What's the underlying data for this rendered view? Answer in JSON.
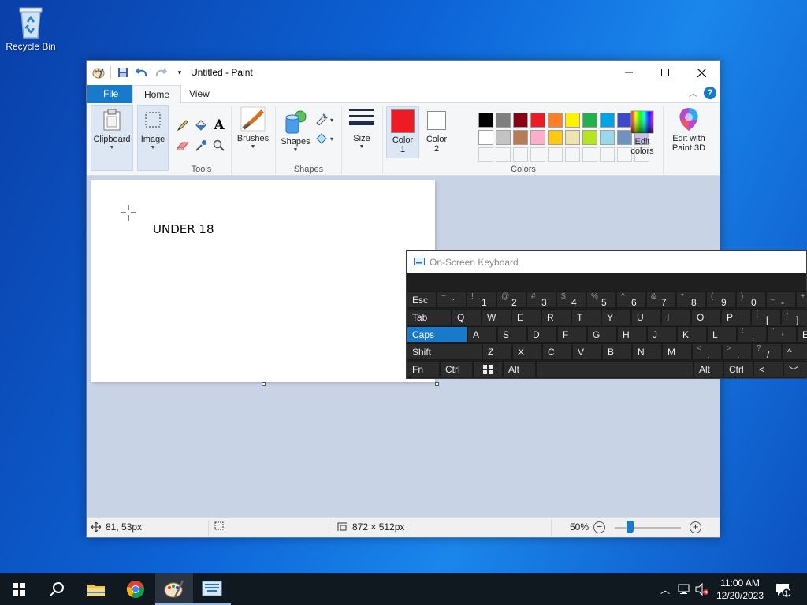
{
  "desktop": {
    "recycle_bin_label": "Recycle Bin"
  },
  "paint": {
    "title": "Untitled - Paint",
    "tabs": {
      "file": "File",
      "home": "Home",
      "view": "View"
    },
    "ribbon": {
      "clipboard": "Clipboard",
      "image": "Image",
      "tools_group": "Tools",
      "brushes": "Brushes",
      "shapes": "Shapes",
      "shapes_group": "Shapes",
      "size": "Size",
      "color1_a": "Color",
      "color1_b": "1",
      "color2_a": "Color",
      "color2_b": "2",
      "colors_group": "Colors",
      "edit_colors_a": "Edit",
      "edit_colors_b": "colors",
      "paint3d_a": "Edit with",
      "paint3d_b": "Paint 3D"
    },
    "color1": "#ed1c24",
    "color2": "#ffffff",
    "palette_row1": [
      "#000000",
      "#7f7f7f",
      "#880015",
      "#ed1c24",
      "#ff7f27",
      "#fff200",
      "#22b14c",
      "#00a2e8",
      "#3f48cc",
      "#a349a4"
    ],
    "palette_row2": [
      "#ffffff",
      "#c3c3c3",
      "#b97a57",
      "#ffaec9",
      "#ffc90e",
      "#efe4b0",
      "#b5e61d",
      "#99d9ea",
      "#7092be",
      "#c8bfe7"
    ],
    "canvas_text": "UNDER 18",
    "status": {
      "cursor_pos": "81, 53px",
      "canvas_size": "872 × 512px",
      "zoom": "50%"
    }
  },
  "osk": {
    "title": "On-Screen Keyboard",
    "row1": [
      {
        "main": "Esc"
      },
      {
        "shift": "~",
        "base": "`"
      },
      {
        "shift": "!",
        "base": "1"
      },
      {
        "shift": "@",
        "base": "2"
      },
      {
        "shift": "#",
        "base": "3"
      },
      {
        "shift": "$",
        "base": "4"
      },
      {
        "shift": "%",
        "base": "5"
      },
      {
        "shift": "^",
        "base": "6"
      },
      {
        "shift": "&",
        "base": "7"
      },
      {
        "shift": "*",
        "base": "8"
      },
      {
        "shift": "(",
        "base": "9"
      },
      {
        "shift": ")",
        "base": "0"
      },
      {
        "shift": "_",
        "base": "-"
      },
      {
        "shift": "+",
        "base": "="
      }
    ],
    "row2": [
      {
        "main": "Tab"
      },
      {
        "main": "Q"
      },
      {
        "main": "W"
      },
      {
        "main": "E"
      },
      {
        "main": "R"
      },
      {
        "main": "T"
      },
      {
        "main": "Y"
      },
      {
        "main": "U"
      },
      {
        "main": "I"
      },
      {
        "main": "O"
      },
      {
        "main": "P"
      },
      {
        "shift": "{",
        "base": "["
      },
      {
        "shift": "}",
        "base": "]"
      }
    ],
    "row3": [
      {
        "main": "Caps"
      },
      {
        "main": "A"
      },
      {
        "main": "S"
      },
      {
        "main": "D"
      },
      {
        "main": "F"
      },
      {
        "main": "G"
      },
      {
        "main": "H"
      },
      {
        "main": "J"
      },
      {
        "main": "K"
      },
      {
        "main": "L"
      },
      {
        "shift": ":",
        "base": ";"
      },
      {
        "shift": "\"",
        "base": "'"
      },
      {
        "main": "En"
      }
    ],
    "row4": [
      {
        "main": "Shift"
      },
      {
        "main": "Z"
      },
      {
        "main": "X"
      },
      {
        "main": "C"
      },
      {
        "main": "V"
      },
      {
        "main": "B"
      },
      {
        "main": "N"
      },
      {
        "main": "M"
      },
      {
        "shift": "<",
        "base": ","
      },
      {
        "shift": ">",
        "base": "."
      },
      {
        "shift": "?",
        "base": "/"
      },
      {
        "main": "^"
      }
    ],
    "row5": {
      "fn": "Fn",
      "ctrl": "Ctrl",
      "alt": "Alt",
      "alt_r": "Alt",
      "ctrl_r": "Ctrl"
    }
  },
  "taskbar": {
    "time": "11:00 AM",
    "date": "12/20/2023",
    "notification_count": "1"
  },
  "icons": [
    "start-icon",
    "search-icon",
    "file-explorer-icon",
    "chrome-icon",
    "paint-icon",
    "osk-icon",
    "chevron-up-icon",
    "network-icon",
    "volume-muted-icon",
    "notification-icon"
  ]
}
